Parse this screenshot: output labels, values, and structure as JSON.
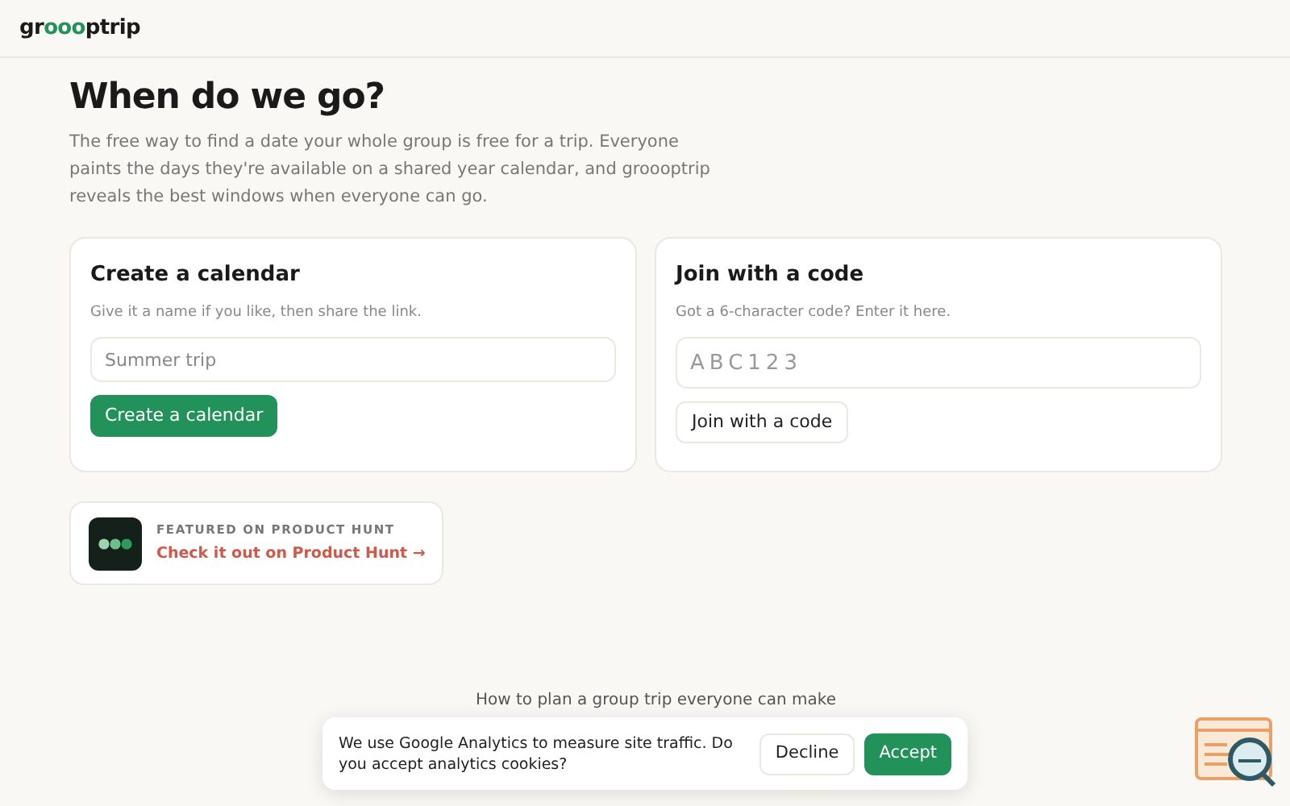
{
  "logo": {
    "parts": [
      {
        "text": "gr",
        "accent": false
      },
      {
        "text": "ooo",
        "accent": true
      },
      {
        "text": "ptrip",
        "accent": false
      }
    ]
  },
  "hero": {
    "title": "When do we go?",
    "description": "The free way to find a date your whole group is free for a trip. Everyone paints the days they're available on a shared year calendar, and groooptrip reveals the best windows when everyone can go."
  },
  "cards": [
    {
      "title": "Create a calendar",
      "hint": "Give it a name if you like, then share the link.",
      "placeholder": "Summer trip",
      "button": "Create a calendar",
      "primary": true,
      "code": false
    },
    {
      "title": "Join with a code",
      "hint": "Got a 6-character code? Enter it here.",
      "placeholder": "ABC123",
      "button": "Join with a code",
      "primary": false,
      "code": true
    }
  ],
  "featured": {
    "label": "FEATURED ON PRODUCT HUNT",
    "link": "Check it out on Product Hunt →"
  },
  "section_heading": "How to plan a group trip everyone can make",
  "cookie_banner": {
    "message": "We use Google Analytics to measure site traffic. Do you accept analytics cookies?",
    "buttons": [
      {
        "label": "Decline",
        "primary": false
      },
      {
        "label": "Accept",
        "primary": true
      }
    ]
  }
}
